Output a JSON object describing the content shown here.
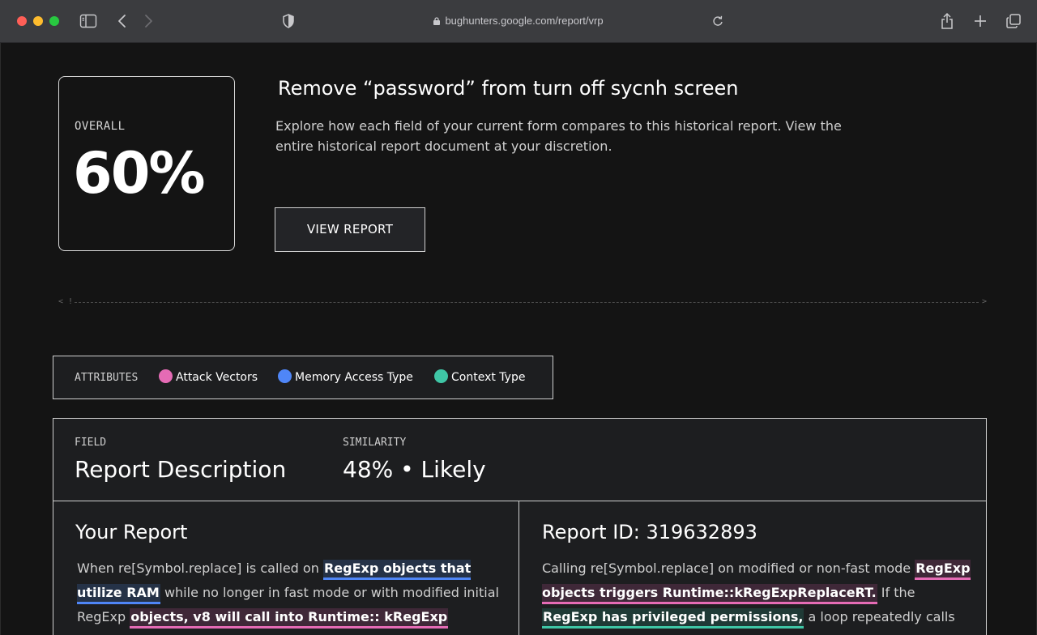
{
  "browser": {
    "url": "bughunters.google.com/report/vrp"
  },
  "overall": {
    "label": "OVERALL",
    "value": "60%"
  },
  "report": {
    "title": "Remove “password” from turn off sycnh screen",
    "description": "Explore how each field of your current form compares to this historical report. View the entire historical report document at your discretion.",
    "view_button": "VIEW REPORT"
  },
  "divider": {
    "left": "< !",
    "right": ">"
  },
  "attributes": {
    "label": "ATTRIBUTES",
    "items": [
      {
        "label": "Attack Vectors",
        "color": "#e56bb5"
      },
      {
        "label": "Memory Access Type",
        "color": "#4f86f7"
      },
      {
        "label": "Context Type",
        "color": "#3fc6a6"
      }
    ]
  },
  "field": {
    "field_label": "FIELD",
    "field_value": "Report Description",
    "similarity_label": "SIMILARITY",
    "similarity_value": "48% • Likely"
  },
  "your_report": {
    "title": "Your Report",
    "text_1": "When re[Symbol.replace] is called on ",
    "hl_1": "RegExp objects that utilize RAM",
    "text_2": " while no longer in fast mode or with modified initial RegExp ",
    "hl_2": "objects, v8 will call into Runtime:: kRegExp"
  },
  "historical": {
    "title": "Report ID: 319632893",
    "text_1": "Calling re[Symbol.replace] on modified or non-fast mode ",
    "hl_1": "RegExp objects triggers Runtime::kRegExpReplaceRT.",
    "text_2": " If the ",
    "hl_2": "RegExp has privileged permissions,",
    "text_3": " a loop repeatedly calls"
  }
}
